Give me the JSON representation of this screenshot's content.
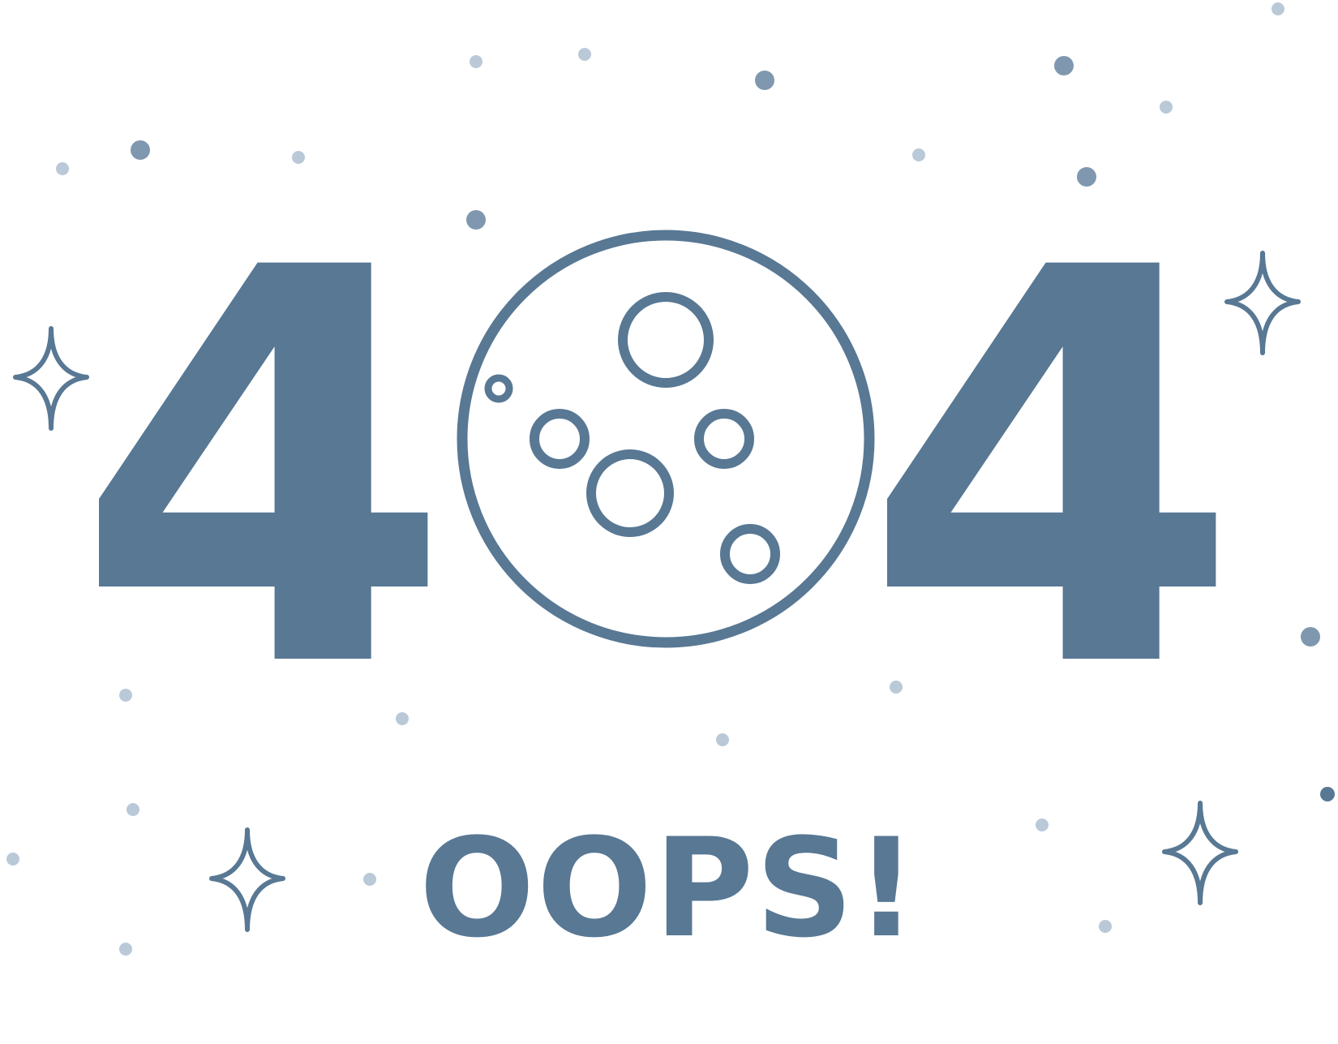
{
  "error": {
    "left_digit": "4",
    "right_digit": "4",
    "center_icon": "moon-icon",
    "message": "OOPS!"
  },
  "icons": {
    "sparkle": "sparkle-icon",
    "star_dot": "star-dot-icon",
    "crater": "crater-icon"
  },
  "colors": {
    "primary": "#587894",
    "moon_shadow": "#d8e0e7",
    "dot_light": "#b9c9d8",
    "dot_medium": "#7f98b0",
    "background": "#ffffff"
  }
}
